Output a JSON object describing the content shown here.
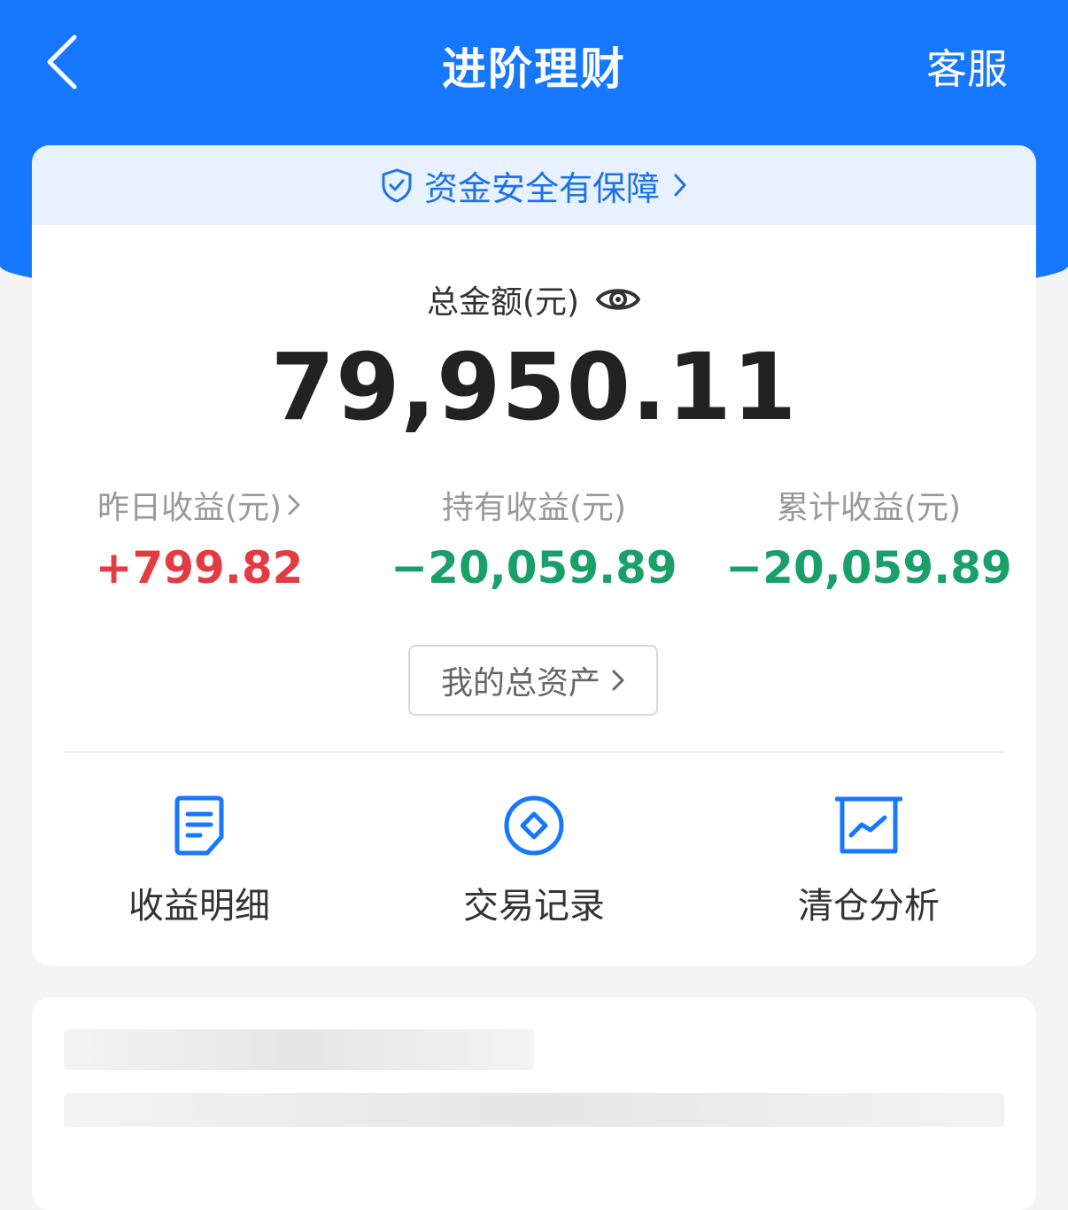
{
  "nav": {
    "title": "进阶理财",
    "service_label": "客服",
    "back_icon": "chevron-left-icon"
  },
  "colors": {
    "brand": "#1677ff",
    "positive": "#e23b41",
    "negative": "#19a06a"
  },
  "safety_banner": {
    "text": "资金安全有保障",
    "icon": "shield-check-icon"
  },
  "summary": {
    "total_label": "总金额(元)",
    "total_value": "79,950.11",
    "visibility_icon": "eye-icon"
  },
  "stats": [
    {
      "label": "昨日收益(元)",
      "value": "+799.82"
    },
    {
      "label": "持有收益(元)",
      "value": "−20,059.89"
    },
    {
      "label": "累计收益(元)",
      "value": "−20,059.89"
    }
  ],
  "assets_button": {
    "label": "我的总资产"
  },
  "shortcuts": [
    {
      "label": "收益明细",
      "icon": "document-list-icon"
    },
    {
      "label": "交易记录",
      "icon": "diamond-circle-icon"
    },
    {
      "label": "清仓分析",
      "icon": "trend-chart-icon"
    }
  ]
}
